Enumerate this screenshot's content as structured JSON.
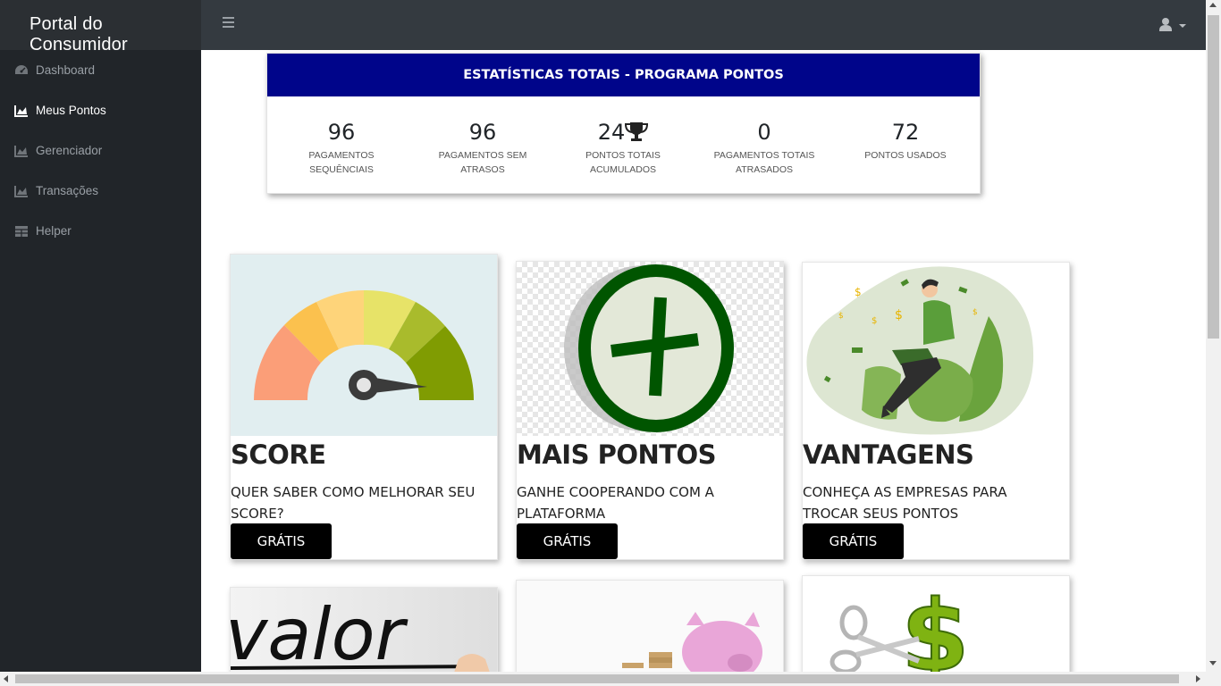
{
  "app": {
    "brand": "Portal do Consumidor"
  },
  "header": {
    "menu_icon": "hamburger-icon",
    "user_icon": "user-icon"
  },
  "sidebar": {
    "items": [
      {
        "label": "Dashboard",
        "icon": "tachometer-icon",
        "active": false
      },
      {
        "label": "Meus Pontos",
        "icon": "area-chart-icon",
        "active": true
      },
      {
        "label": "Gerenciador",
        "icon": "area-chart-icon",
        "active": false
      },
      {
        "label": "Transações",
        "icon": "area-chart-icon",
        "active": false
      },
      {
        "label": "Helper",
        "icon": "table-icon",
        "active": false
      }
    ]
  },
  "stats": {
    "title": "ESTATÍSTICAS TOTAIS - PROGRAMA PONTOS",
    "items": [
      {
        "value": "96",
        "label": "PAGAMENTOS SEQUÊNCIAIS"
      },
      {
        "value": "96",
        "label": "PAGAMENTOS SEM ATRASOS"
      },
      {
        "value": "24",
        "label": "PONTOS TOTAIS ACUMULADOS",
        "icon": "trophy-icon"
      },
      {
        "value": "0",
        "label": "PAGAMENTOS TOTAIS ATRASADOS"
      },
      {
        "value": "72",
        "label": "PONTOS USADOS"
      }
    ]
  },
  "cards": [
    {
      "title": "SCORE",
      "text": "QUER SABER COMO MELHORAR SEU SCORE?",
      "button": "GRÁTIS",
      "image": "gauge-image"
    },
    {
      "title": "MAIS PONTOS",
      "text": "GANHE COOPERANDO COM A PLATAFORMA",
      "button": "GRÁTIS",
      "image": "plus-circle-image"
    },
    {
      "title": "VANTAGENS",
      "text": "CONHEÇA AS EMPRESAS PARA TROCAR SEUS PONTOS",
      "button": "GRÁTIS",
      "image": "person-laptop-image"
    }
  ],
  "bottom_cards": [
    {
      "image": "valor-handwriting-image",
      "image_text": "valor"
    },
    {
      "image": "piggy-bank-coins-image"
    },
    {
      "image": "scissors-dollar-image"
    }
  ]
}
